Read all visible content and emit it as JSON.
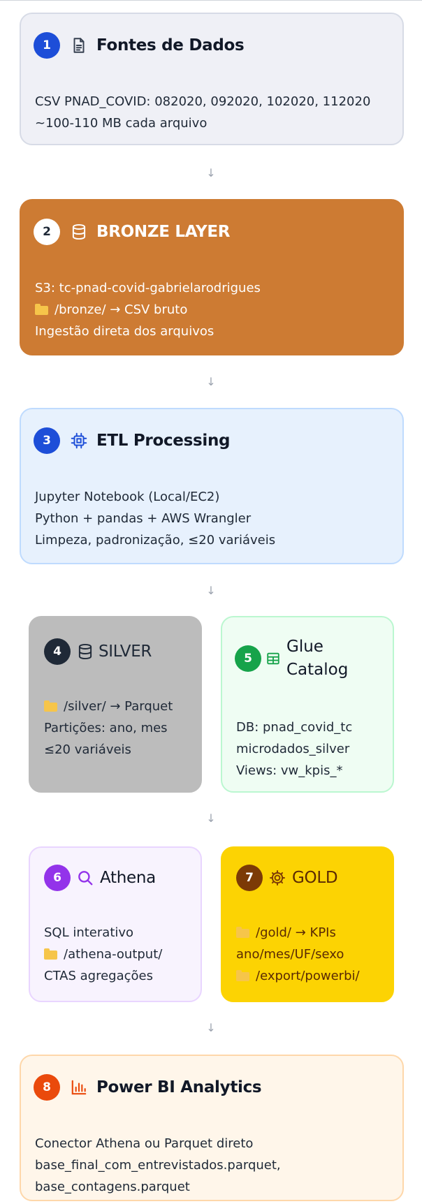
{
  "steps": [
    {
      "number": "1",
      "title": "Fontes de Dados",
      "icon": "document-icon",
      "lines": [
        {
          "text": "CSV PNAD_COVID: 082020, 092020, 102020, 112020"
        },
        {
          "text": "~100-110 MB cada arquivo"
        }
      ]
    },
    {
      "number": "2",
      "title": "BRONZE LAYER",
      "icon": "database-icon",
      "lines": [
        {
          "text": "S3: tc-pnad-covid-gabrielarodrigues"
        },
        {
          "text": "/bronze/ → CSV bruto",
          "folder": true
        },
        {
          "text": "Ingestão direta dos arquivos"
        }
      ]
    },
    {
      "number": "3",
      "title": "ETL Processing",
      "icon": "cpu-icon",
      "lines": [
        {
          "text": "Jupyter Notebook (Local/EC2)"
        },
        {
          "text": "Python + pandas + AWS Wrangler"
        },
        {
          "text": "Limpeza, padronização, ≤20 variáveis"
        }
      ]
    },
    {
      "number": "4",
      "title": "SILVER",
      "icon": "database-icon",
      "lines": [
        {
          "text": "/silver/ → Parquet",
          "folder": true
        },
        {
          "text": "Partições: ano, mes"
        },
        {
          "text": "≤20 variáveis"
        }
      ]
    },
    {
      "number": "5",
      "title_lines": [
        "Glue",
        "Catalog"
      ],
      "icon": "table-icon",
      "lines": [
        {
          "text": "DB: pnad_covid_tc"
        },
        {
          "text": "microdados_silver"
        },
        {
          "text": "Views: vw_kpis_*"
        }
      ]
    },
    {
      "number": "6",
      "title": "Athena",
      "icon": "search-icon",
      "lines": [
        {
          "text": "SQL interativo"
        },
        {
          "text": "/athena-output/",
          "folder": true
        },
        {
          "text": "CTAS agregações"
        }
      ]
    },
    {
      "number": "7",
      "title": "GOLD",
      "icon": "gear-icon",
      "lines": [
        {
          "text": "/gold/ → KPIs",
          "folder": true
        },
        {
          "text": "ano/mes/UF/sexo"
        },
        {
          "text": "/export/powerbi/",
          "folder": true
        }
      ]
    },
    {
      "number": "8",
      "title": "Power BI Analytics",
      "icon": "bar-chart-icon",
      "lines": [
        {
          "text": "Conector Athena ou Parquet direto"
        },
        {
          "text": "base_final_com_entrevistados.parquet,"
        },
        {
          "text": "base_contagens.parquet"
        }
      ]
    }
  ],
  "arrow_symbol": "↓",
  "colors": {
    "blue": "#1d4ed8",
    "bronze": "#cd7b33",
    "dark": "#1f2937",
    "green": "#16a34a",
    "purple": "#9333ea",
    "brown": "#7c3a06",
    "orange": "#ea4a0c",
    "gold": "#fcd303",
    "silver": "#bcbcbc"
  }
}
